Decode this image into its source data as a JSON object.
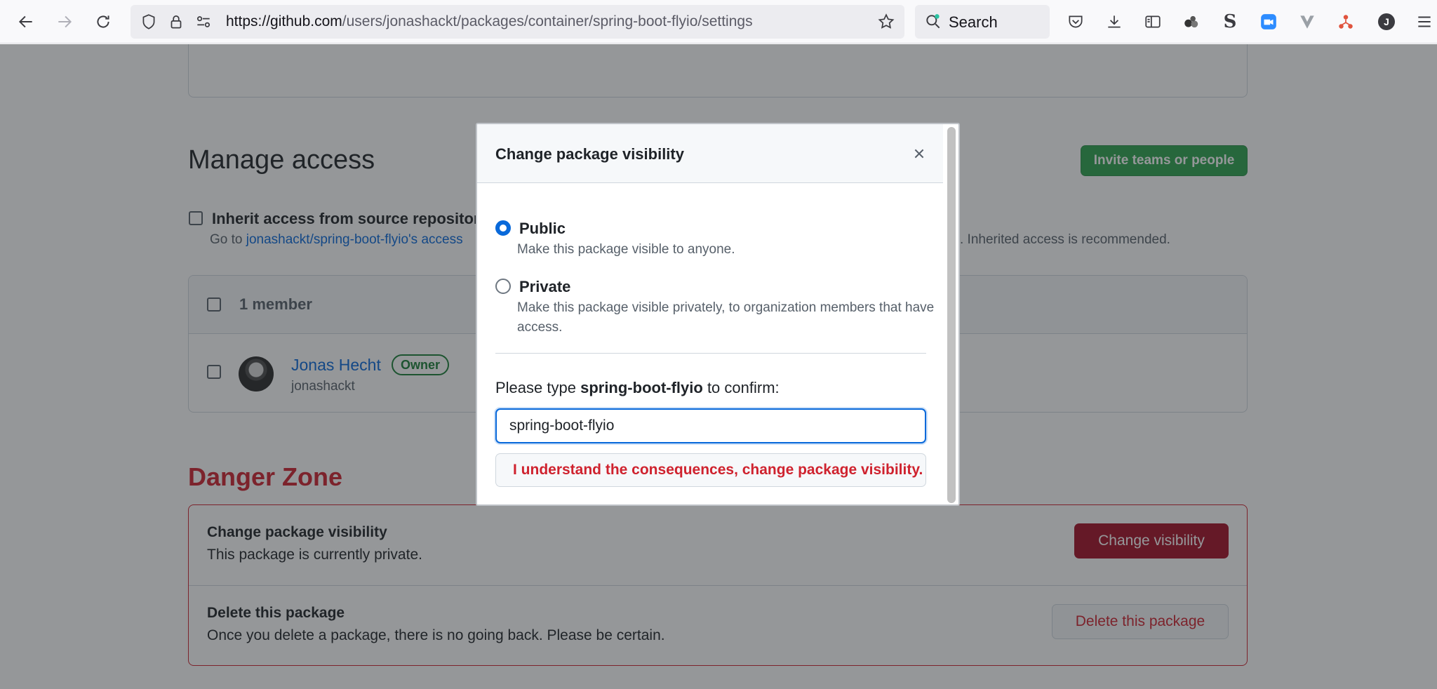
{
  "browser": {
    "url_host": "https://github.com",
    "url_path": "/users/jonashackt/packages/container/spring-boot-flyio/settings",
    "search_label": "Search",
    "profile_initial": "J"
  },
  "manage_access": {
    "title": "Manage access",
    "invite_label": "Invite teams or people",
    "inherit_label": "Inherit access from source repositor",
    "inherit_desc_prefix": "Go to ",
    "inherit_desc_link": "jonashackt/spring-boot-flyio's access",
    "inherit_desc_suffix": ". Inherited access is recommended.",
    "members_count": "1 member",
    "member": {
      "name": "Jonas Hecht",
      "badge": "Owner",
      "login": "jonashackt"
    }
  },
  "danger_zone": {
    "title": "Danger Zone",
    "visibility_title": "Change package visibility",
    "visibility_desc": "This package is currently private.",
    "visibility_button": "Change visibility",
    "delete_title": "Delete this package",
    "delete_desc": "Once you delete a package, there is no going back. Please be certain.",
    "delete_button": "Delete this package"
  },
  "dialog": {
    "title": "Change package visibility",
    "public_label": "Public",
    "public_desc": "Make this package visible to anyone.",
    "private_label": "Private",
    "private_desc": "Make this package visible privately, to organization members that have access.",
    "selected": "public",
    "confirm_prefix": "Please type ",
    "confirm_name": "spring-boot-flyio",
    "confirm_suffix": " to confirm:",
    "input_value": "spring-boot-flyio",
    "confirm_button": "I understand the consequences, change package visibility."
  },
  "colors": {
    "primary_green": "#2da44e",
    "danger_red": "#cf222e",
    "link_blue": "#0969da"
  }
}
